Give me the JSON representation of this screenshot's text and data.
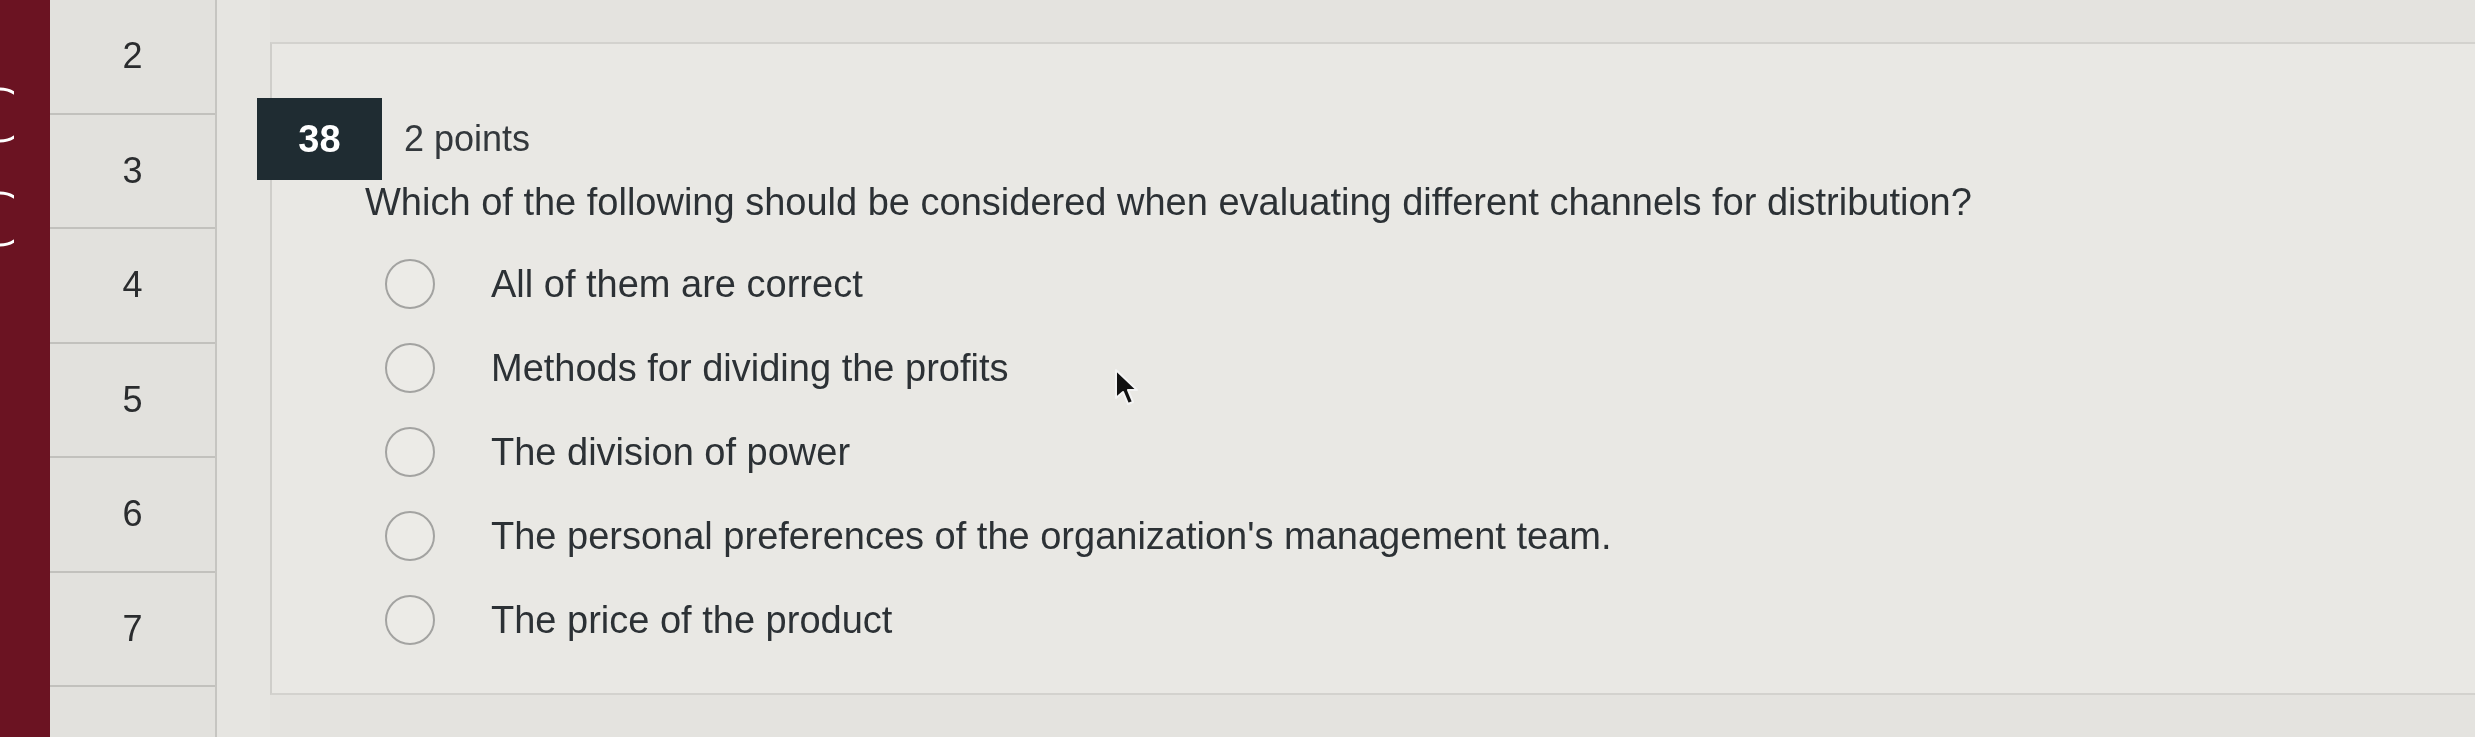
{
  "nav": {
    "items": [
      {
        "label": "2"
      },
      {
        "label": "3"
      },
      {
        "label": "4"
      },
      {
        "label": "5"
      },
      {
        "label": "6"
      },
      {
        "label": "7"
      }
    ]
  },
  "question": {
    "number": "38",
    "points": "2 points",
    "text": "Which of the following should be considered when evaluating different channels for distribution?",
    "options": [
      {
        "label": "All of them are correct",
        "selected": false
      },
      {
        "label": "Methods for dividing the profits",
        "selected": false
      },
      {
        "label": "The division of power",
        "selected": false
      },
      {
        "label": "The personal preferences of the organization's management team.",
        "selected": false
      },
      {
        "label": "The price of the product",
        "selected": false
      }
    ]
  }
}
